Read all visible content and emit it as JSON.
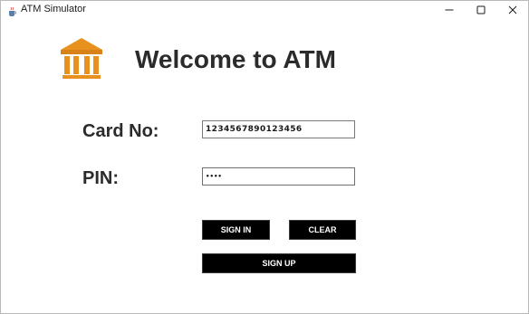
{
  "window": {
    "title": "ATM Simulator",
    "app_icon": "java-cup-icon",
    "controls": {
      "minimize_icon": "minimize-icon",
      "maximize_icon": "maximize-icon",
      "close_icon": "close-icon"
    }
  },
  "header": {
    "logo_icon": "bank-building-icon",
    "title": "Welcome to ATM",
    "accent_color": "#e8911e"
  },
  "form": {
    "card_label": "Card No:",
    "card_value": "1234567890123456",
    "pin_label": "PIN:",
    "pin_value": "••••"
  },
  "buttons": {
    "sign_in": "SIGN IN",
    "clear": "CLEAR",
    "sign_up": "SIGN UP"
  }
}
